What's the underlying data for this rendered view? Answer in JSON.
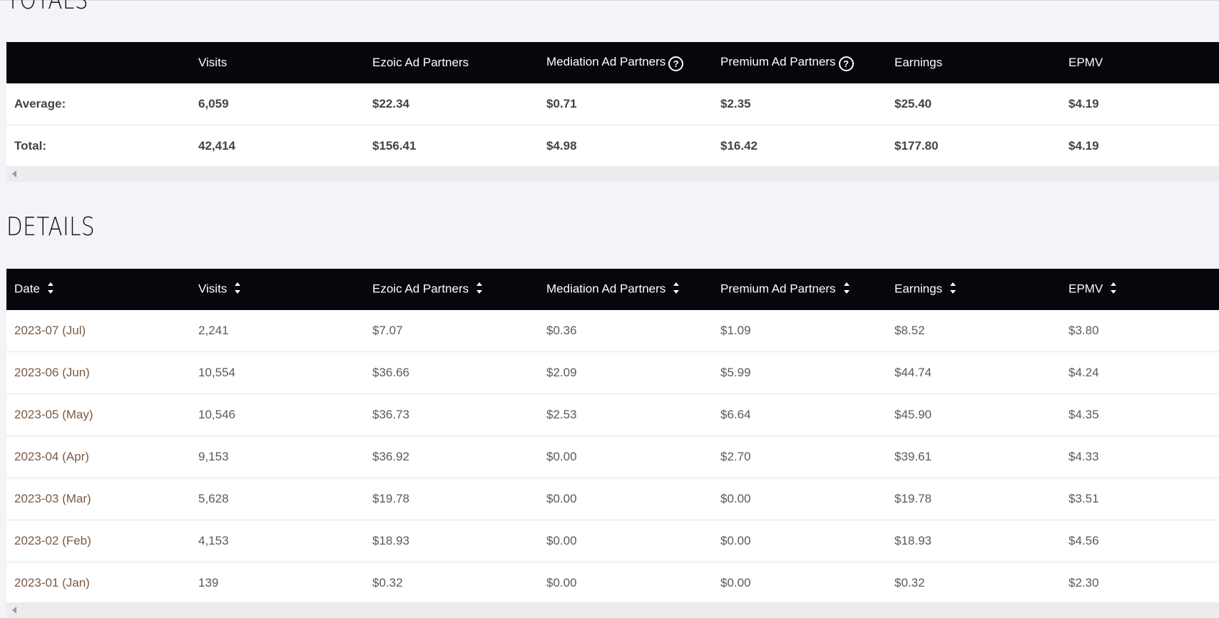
{
  "totals": {
    "title": "TOTALS",
    "headers": [
      "",
      "Visits",
      "Ezoic Ad Partners",
      "Mediation Ad Partners",
      "Premium Ad Partners",
      "Earnings",
      "EPMV"
    ],
    "rows": [
      [
        "Average:",
        "6,059",
        "$22.34",
        "$0.71",
        "$2.35",
        "$25.40",
        "$4.19"
      ],
      [
        "Total:",
        "42,414",
        "$156.41",
        "$4.98",
        "$16.42",
        "$177.80",
        "$4.19"
      ]
    ],
    "help_symbol": "?"
  },
  "details": {
    "title": "DETAILS",
    "headers": [
      "Date",
      "Visits",
      "Ezoic Ad Partners",
      "Mediation Ad Partners",
      "Premium Ad Partners",
      "Earnings",
      "EPMV"
    ],
    "rows": [
      [
        "2023-07 (Jul)",
        "2,241",
        "$7.07",
        "$0.36",
        "$1.09",
        "$8.52",
        "$3.80"
      ],
      [
        "2023-06 (Jun)",
        "10,554",
        "$36.66",
        "$2.09",
        "$5.99",
        "$44.74",
        "$4.24"
      ],
      [
        "2023-05 (May)",
        "10,546",
        "$36.73",
        "$2.53",
        "$6.64",
        "$45.90",
        "$4.35"
      ],
      [
        "2023-04 (Apr)",
        "9,153",
        "$36.92",
        "$0.00",
        "$2.70",
        "$39.61",
        "$4.33"
      ],
      [
        "2023-03 (Mar)",
        "5,628",
        "$19.78",
        "$0.00",
        "$0.00",
        "$19.78",
        "$3.51"
      ],
      [
        "2023-02 (Feb)",
        "4,153",
        "$18.93",
        "$0.00",
        "$0.00",
        "$18.93",
        "$4.56"
      ],
      [
        "2023-01 (Jan)",
        "139",
        "$0.32",
        "$0.00",
        "$0.00",
        "$0.32",
        "$2.30"
      ]
    ]
  },
  "icons": {
    "help": "question-circle-icon",
    "sort": "sort-updown-icon",
    "scroll_left": "scroll-left-arrow-icon"
  },
  "colors": {
    "header_bg": "#05070c",
    "page_bg": "#f3f3f8",
    "date_text": "#7a5a45"
  }
}
